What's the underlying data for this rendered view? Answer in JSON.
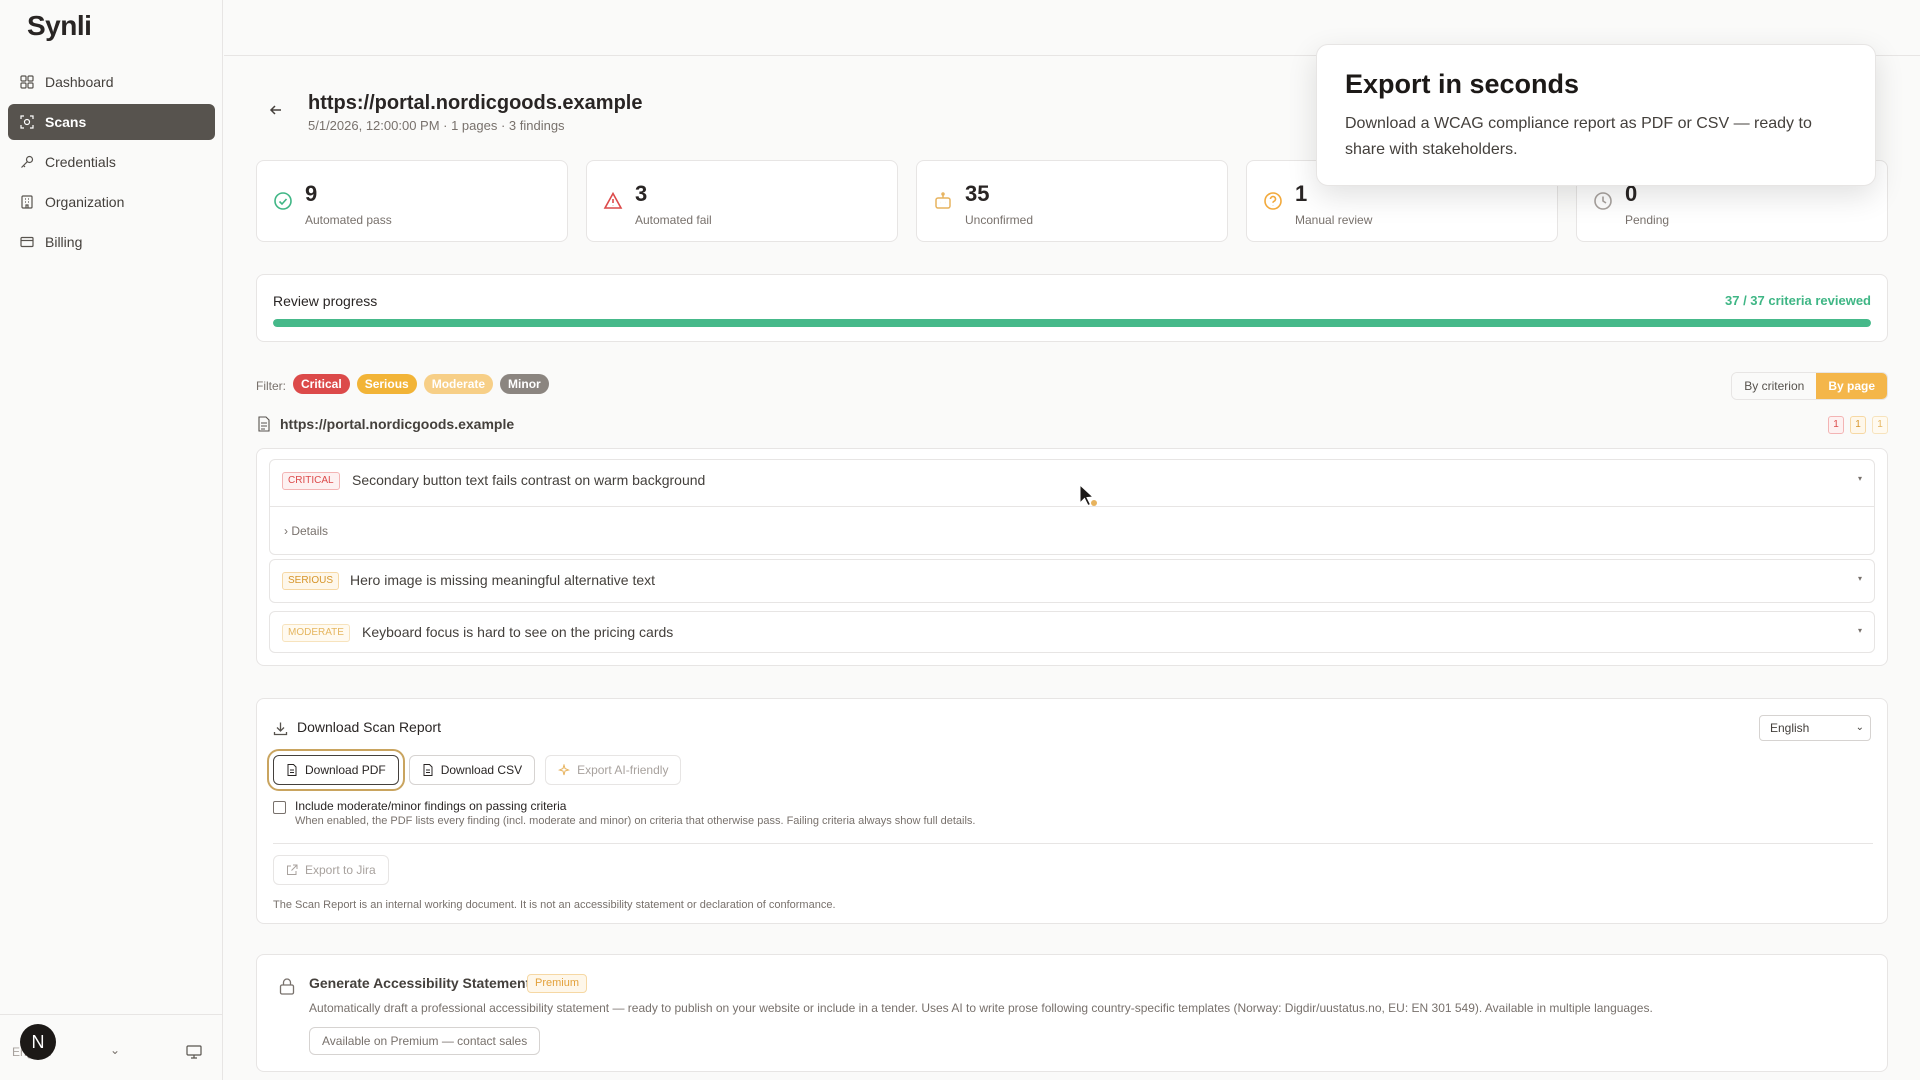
{
  "app": {
    "name": "Synli"
  },
  "sidebar": {
    "items": [
      {
        "label": "Dashboard",
        "icon": "grid-icon",
        "active": false
      },
      {
        "label": "Scans",
        "icon": "scan-icon",
        "active": true
      },
      {
        "label": "Credentials",
        "icon": "key-icon",
        "active": false
      },
      {
        "label": "Organization",
        "icon": "building-icon",
        "active": false
      },
      {
        "label": "Billing",
        "icon": "card-icon",
        "active": false
      }
    ],
    "footer": {
      "language": "English",
      "avatar_initial": "N"
    }
  },
  "scan": {
    "url": "https://portal.nordicgoods.example",
    "meta": "5/1/2026, 12:00:00 PM · 1 pages · 3 findings"
  },
  "stats": [
    {
      "value": "9",
      "label": "Automated pass",
      "icon": "check-circle-icon",
      "color": "#3fb685"
    },
    {
      "value": "3",
      "label": "Automated fail",
      "icon": "warning-triangle-icon",
      "color": "#dc4a4a"
    },
    {
      "value": "35",
      "label": "Unconfirmed",
      "icon": "robot-icon",
      "color": "#e7b35e"
    },
    {
      "value": "1",
      "label": "Manual review",
      "icon": "question-circle-icon",
      "color": "#f2a93b"
    },
    {
      "value": "0",
      "label": "Pending",
      "icon": "clock-icon",
      "color": "#a8a29e"
    }
  ],
  "progress": {
    "label": "Review progress",
    "count_text": "37 / 37 criteria reviewed",
    "fraction": 1.0
  },
  "filter": {
    "label": "Filter:",
    "chips": [
      "Critical",
      "Serious",
      "Moderate",
      "Minor"
    ],
    "views": [
      "By criterion",
      "By page"
    ],
    "active_view": "By page"
  },
  "page_group": {
    "url": "https://portal.nordicgoods.example",
    "counts": [
      "1",
      "1",
      "1"
    ]
  },
  "findings": [
    {
      "severity": "critical",
      "title": "Secondary button text fails contrast on warm background",
      "details_label": "Details"
    },
    {
      "severity": "serious",
      "title": "Hero image is missing meaningful alternative text"
    },
    {
      "severity": "moderate",
      "title": "Keyboard focus is hard to see on the pricing cards"
    }
  ],
  "report": {
    "title": "Download Scan Report",
    "language": "English",
    "download_pdf": "Download PDF",
    "download_csv": "Download CSV",
    "export_ai": "Export AI-friendly",
    "include_label": "Include moderate/minor findings on passing criteria",
    "include_help": "When enabled, the PDF lists every finding (incl. moderate and minor) on criteria that otherwise pass. Failing criteria always show full details.",
    "export_jira": "Export to Jira",
    "note": "The Scan Report is an internal working document. It is not an accessibility statement or declaration of conformance."
  },
  "statement": {
    "title": "Generate Accessibility Statement",
    "badge": "Premium",
    "description": "Automatically draft a professional accessibility statement — ready to publish on your website or include in a tender. Uses AI to write prose following country-specific templates (Norway: Digdir/uustatus.no, EU: EN 301 549). Available in multiple languages.",
    "button": "Available on Premium — contact sales"
  },
  "tour": {
    "title": "Export in seconds",
    "body": "Download a WCAG compliance report as PDF or CSV — ready to share with stakeholders."
  }
}
